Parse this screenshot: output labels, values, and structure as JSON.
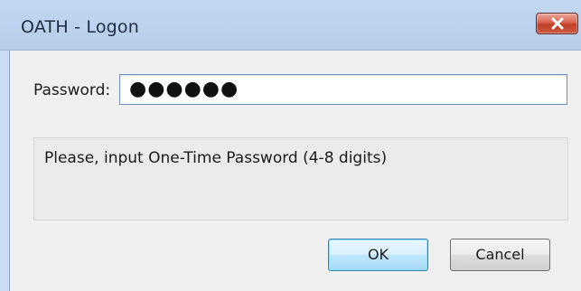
{
  "window": {
    "title": "OATH - Logon"
  },
  "icons": {
    "close": "close-icon"
  },
  "form": {
    "password_label": "Password:",
    "password_value": "●●●●●●"
  },
  "message": {
    "text": "Please, input One-Time Password (4-8 digits)"
  },
  "buttons": {
    "ok_label": "OK",
    "cancel_label": "Cancel"
  },
  "colors": {
    "titlebar": "#bcd2ee",
    "close_button": "#c13e28",
    "dialog_background": "#f0f0f0",
    "default_button_border": "#3c7fb1"
  }
}
